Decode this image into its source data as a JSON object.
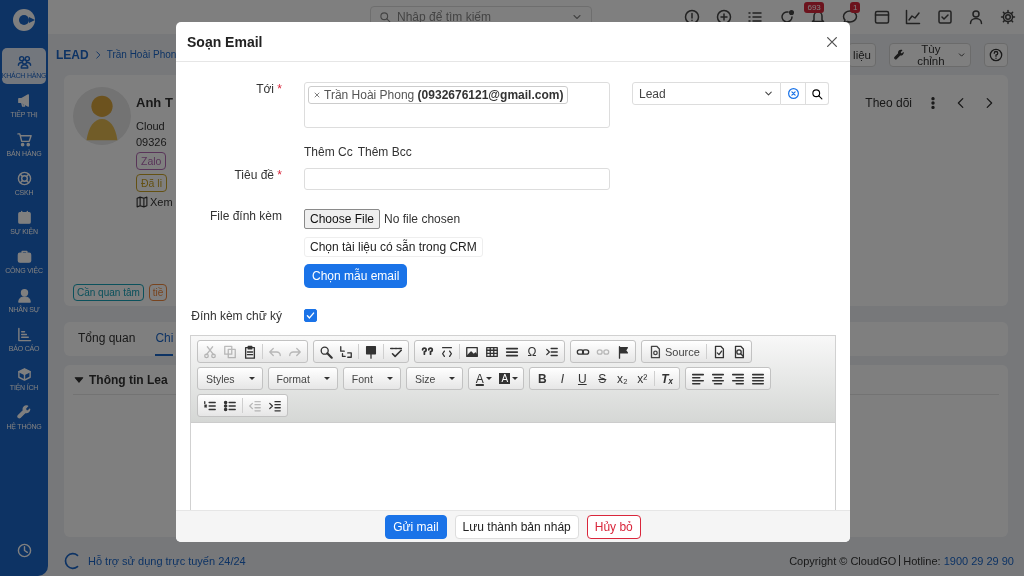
{
  "sidebar": {
    "items": [
      {
        "label": "KHÁCH HÀNG",
        "selected": true
      },
      {
        "label": "TIẾP THỊ",
        "selected": false
      },
      {
        "label": "BÁN HÀNG",
        "selected": false
      },
      {
        "label": "CSKH",
        "selected": false
      },
      {
        "label": "SỰ KIỆN",
        "selected": false
      },
      {
        "label": "CÔNG VIỆC",
        "selected": false
      },
      {
        "label": "NHÂN SỰ",
        "selected": false
      },
      {
        "label": "BÁO CÁO",
        "selected": false
      },
      {
        "label": "TIỆN ÍCH",
        "selected": false
      },
      {
        "label": "HỆ THỐNG",
        "selected": false
      }
    ]
  },
  "topbar": {
    "search": {
      "placeholder": "Nhập để tìm kiếm"
    },
    "notification_count": "693",
    "message_count": "1"
  },
  "breadcrumb": {
    "module": "LEAD",
    "record": "Trần Hoài Phon"
  },
  "page_actions": [
    "liệu",
    "Tùy chỉnh"
  ],
  "profile": {
    "name": "Anh T",
    "company": "Cloud",
    "phone": "09326",
    "tags": [
      {
        "label": "Zalo"
      },
      {
        "label": "Đã li"
      }
    ],
    "map_link": "Xem",
    "status_tags": [
      {
        "label": "Cần quan tâm"
      },
      {
        "label": "tiề"
      }
    ],
    "follow_button": "Theo dõi"
  },
  "tabs": [
    {
      "label": "Tổng quan",
      "selected": false
    },
    {
      "label": "Chi",
      "selected": true
    }
  ],
  "section": {
    "title": "Thông tin Lea",
    "expanded": true
  },
  "footer": {
    "support": "Hỗ trợ sử dụng trực tuyến 24/24",
    "copyright": "Copyright © CloudGO",
    "hotline_label": "Hotline:",
    "hotline": "1900 29 29 90"
  },
  "email_dialog": {
    "title": "Soạn Email",
    "to": {
      "label": "Tới",
      "required_mark": "*",
      "recipients": [
        {
          "name": "Trần Hoài Phong",
          "email": "(0932676121@gmail.com)"
        }
      ]
    },
    "module_select": {
      "value": "Lead"
    },
    "cc_links": [
      "Thêm Cc",
      "Thêm Bcc"
    ],
    "subject": {
      "label": "Tiêu đề",
      "required_mark": "*"
    },
    "attachment": {
      "label": "File đính kèm",
      "choose_button": "Choose File",
      "status": "No file chosen",
      "crm_button": "Chọn tài liệu có sẵn trong CRM"
    },
    "template_button": "Chọn mẫu email",
    "signature": {
      "label": "Đính kèm chữ ký",
      "checked": true
    },
    "editor": {
      "toolbar": [
        [
          [
            [
              {
                "kind": "icon",
                "disabled": true
              },
              {
                "kind": "icon",
                "disabled": true
              },
              {
                "kind": "icon",
                "disabled": false
              }
            ],
            [
              {
                "kind": "icon",
                "disabled": true
              },
              {
                "kind": "icon",
                "disabled": true
              }
            ]
          ],
          [
            [
              {
                "kind": "icon",
                "disabled": false
              },
              {
                "kind": "icon",
                "disabled": false
              }
            ],
            [
              {
                "kind": "icon",
                "disabled": false
              }
            ],
            [
              {
                "kind": "icon",
                "disabled": false
              }
            ]
          ],
          [
            [
              {
                "kind": "icon",
                "disabled": false
              },
              {
                "kind": "icon",
                "disabled": false
              }
            ],
            [
              {
                "kind": "icon",
                "disabled": false
              },
              {
                "kind": "icon",
                "disabled": false
              },
              {
                "kind": "icon",
                "disabled": false
              },
              {
                "kind": "glyph",
                "label": "Ω",
                "disabled": false
              },
              {
                "kind": "icon",
                "disabled": false
              }
            ]
          ],
          [
            [
              {
                "kind": "icon",
                "disabled": false
              },
              {
                "kind": "icon",
                "disabled": true
              },
              {
                "kind": "icon",
                "disabled": false
              }
            ]
          ],
          [
            [
              {
                "kind": "labeled",
                "label": "Source",
                "disabled": false
              }
            ],
            [
              {
                "kind": "icon",
                "disabled": false
              },
              {
                "kind": "icon",
                "disabled": false
              }
            ]
          ]
        ],
        [
          [
            [
              {
                "kind": "combo",
                "label": "Styles",
                "disabled": false
              }
            ]
          ],
          [
            [
              {
                "kind": "combo",
                "label": "Format",
                "disabled": false
              }
            ]
          ],
          [
            [
              {
                "kind": "combo",
                "label": "Font",
                "disabled": false
              }
            ]
          ],
          [
            [
              {
                "kind": "combo",
                "label": "Size",
                "disabled": false
              }
            ]
          ],
          [
            [
              {
                "kind": "color",
                "label": "A",
                "disabled": false
              },
              {
                "kind": "highlight",
                "label": "A",
                "disabled": false
              }
            ]
          ],
          [
            [
              {
                "kind": "bold",
                "label": "B",
                "disabled": false
              },
              {
                "kind": "italic",
                "label": "I",
                "disabled": false
              },
              {
                "kind": "underline",
                "label": "U",
                "disabled": false
              },
              {
                "kind": "strike",
                "label": "S",
                "disabled": false
              },
              {
                "kind": "glyph",
                "label": "x₂",
                "disabled": false
              },
              {
                "kind": "glyph",
                "label": "x²",
                "disabled": false
              }
            ],
            [
              {
                "kind": "clear",
                "label": "Tₓ",
                "disabled": false
              }
            ]
          ],
          [
            [
              {
                "kind": "icon",
                "disabled": false
              },
              {
                "kind": "icon",
                "disabled": false
              },
              {
                "kind": "icon",
                "disabled": false
              },
              {
                "kind": "icon",
                "disabled": false
              }
            ]
          ]
        ],
        [
          [
            [
              {
                "kind": "icon",
                "disabled": false
              },
              {
                "kind": "icon",
                "disabled": false
              }
            ],
            [
              {
                "kind": "icon",
                "disabled": true
              },
              {
                "kind": "icon",
                "disabled": false
              }
            ]
          ]
        ]
      ]
    },
    "buttons": [
      {
        "label": "Gửi mail",
        "kind": "primary"
      },
      {
        "label": "Lưu thành bản nháp",
        "kind": "default"
      },
      {
        "label": "Hủy bỏ",
        "kind": "danger"
      }
    ]
  }
}
